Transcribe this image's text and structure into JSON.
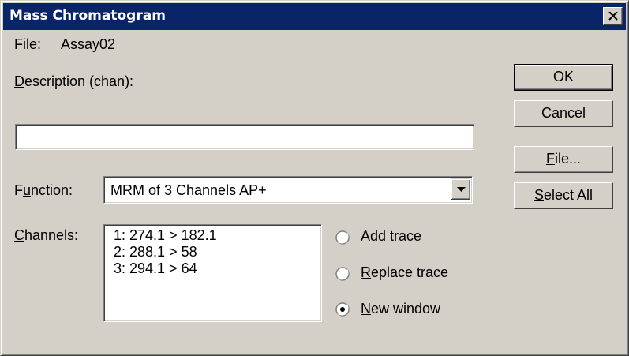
{
  "window": {
    "title": "Mass Chromatogram",
    "close_icon": "close-icon"
  },
  "file": {
    "label": "File:",
    "value": "Assay02"
  },
  "description": {
    "label_mnemonic": "D",
    "label_rest": "escription (chan):",
    "value": ""
  },
  "function": {
    "label_pre": "F",
    "label_mnemonic": "u",
    "label_rest": "nction:",
    "selected": "MRM of 3 Channels AP+",
    "dropdown_icon": "chevron-down-icon"
  },
  "channels": {
    "label_mnemonic": "C",
    "label_rest": "hannels:",
    "items": [
      "1: 274.1 > 182.1",
      "2: 288.1 > 58",
      "3: 294.1 > 64"
    ]
  },
  "trace_options": {
    "selected": "new_window",
    "items": [
      {
        "id": "add_trace",
        "mnemonic": "A",
        "rest": "dd trace",
        "checked": false
      },
      {
        "id": "replace_trace",
        "mnemonic": "R",
        "rest": "eplace trace",
        "checked": false
      },
      {
        "id": "new_window",
        "mnemonic": "N",
        "rest": "ew window",
        "checked": true
      }
    ]
  },
  "buttons": {
    "ok": "OK",
    "cancel": "Cancel",
    "file_mnemonic": "F",
    "file_rest": "ile...",
    "select_all_mnemonic": "S",
    "select_all_rest": "elect All"
  },
  "colors": {
    "title_bar": "#0a246a",
    "dialog_bg": "#d4d0c8"
  }
}
